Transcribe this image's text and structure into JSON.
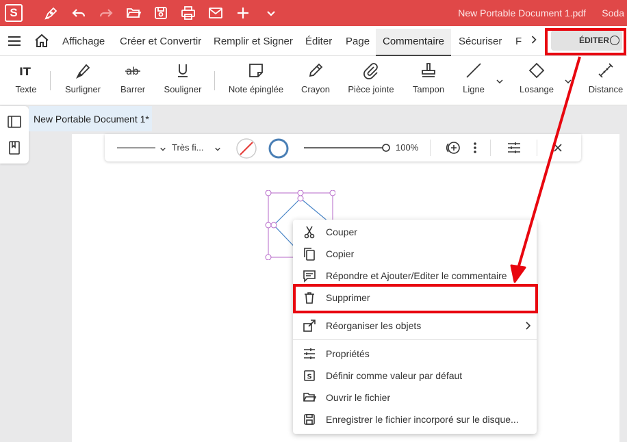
{
  "titlebar": {
    "logo": "S",
    "document_title": "New Portable Document 1.pdf",
    "app_title": "Soda",
    "icons": [
      "pen-icon",
      "undo-icon",
      "redo-icon",
      "open-folder-icon",
      "save-icon",
      "print-icon",
      "mail-icon",
      "plus-icon",
      "chevron-down-icon"
    ]
  },
  "menubar": {
    "items": [
      "Affichage",
      "Créer et Convertir",
      "Remplir et Signer",
      "Éditer",
      "Page",
      "Commentaire",
      "Sécuriser",
      "F"
    ],
    "active": "Commentaire",
    "edit_toggle_label": "ÉDITER"
  },
  "ribbon": {
    "tools": [
      "Texte",
      "Surligner",
      "Barrer",
      "Souligner",
      "Note épinglée",
      "Crayon",
      "Pièce jointe",
      "Tampon",
      "Ligne",
      "Losange",
      "Distance"
    ]
  },
  "doctab": {
    "label": "New Portable Document 1*"
  },
  "property_toolbar": {
    "line_style": "Très fi...",
    "zoom": "100%"
  },
  "context_menu": {
    "items": [
      {
        "label": "Couper"
      },
      {
        "label": "Copier"
      },
      {
        "label": "Répondre et Ajouter/Editer le commentaire"
      },
      {
        "label": "Supprimer"
      },
      {
        "label": "Réorganiser les objets"
      },
      {
        "label": "Propriétés"
      },
      {
        "label": "Définir comme valeur par défaut"
      },
      {
        "label": "Ouvrir le fichier"
      },
      {
        "label": "Enregistrer le fichier incorporé sur le disque..."
      }
    ]
  },
  "colors": {
    "titlebar": "#e04848",
    "annotation_red": "#e8060f",
    "shape_stroke": "#4a86c8",
    "selection": "#b567c8"
  }
}
